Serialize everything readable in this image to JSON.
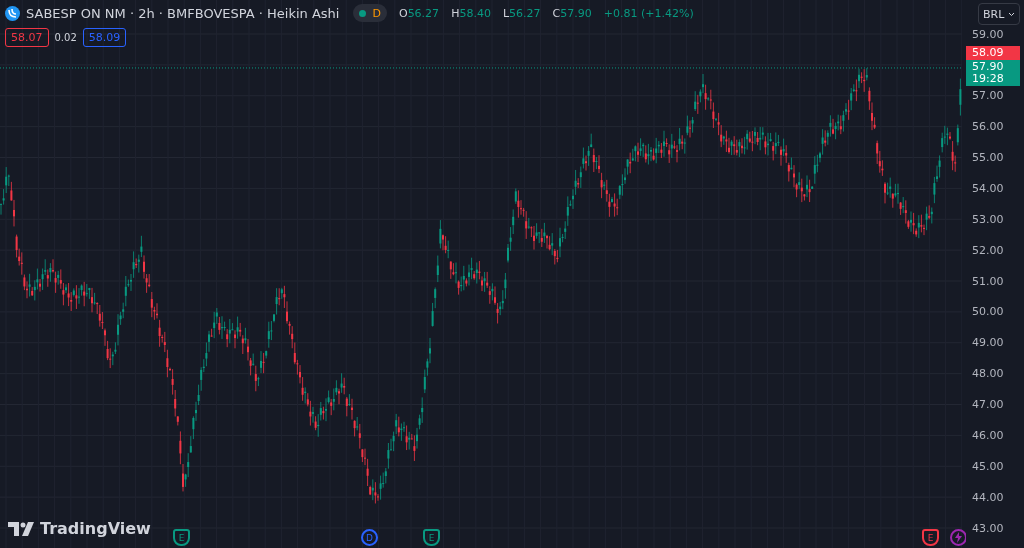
{
  "symbol": {
    "title": "SABESP ON NM · 2h · BMFBOVESPA · Heikin Ashi",
    "market_status": "D",
    "ohlc": [
      {
        "label": "O",
        "value": "56.27"
      },
      {
        "label": "H",
        "value": "58.40"
      },
      {
        "label": "L",
        "value": "56.27"
      },
      {
        "label": "C",
        "value": "57.90"
      }
    ],
    "change": "+0.81 (+1.42%)"
  },
  "quote": {
    "bid": "58.07",
    "spread": "0.02",
    "ask": "58.09"
  },
  "price_axis": {
    "currency": "BRL",
    "ticks": [
      "59.00",
      "57.00",
      "56.00",
      "55.00",
      "54.00",
      "53.00",
      "52.00",
      "51.00",
      "50.00",
      "49.00",
      "48.00",
      "47.00",
      "46.00",
      "45.00",
      "44.00",
      "43.00"
    ],
    "ask_label": "58.09",
    "last_price": "57.90",
    "countdown": "19:28"
  },
  "events": [
    {
      "kind": "letter",
      "label": "E",
      "color": "#089981"
    },
    {
      "kind": "letter",
      "label": "D",
      "color": "#2962ff"
    },
    {
      "kind": "letter",
      "label": "E",
      "color": "#089981"
    },
    {
      "kind": "letter",
      "label": "E",
      "color": "#f23645"
    },
    {
      "kind": "lightning",
      "color": "#9c27b0"
    }
  ],
  "brand": "TradingView"
}
